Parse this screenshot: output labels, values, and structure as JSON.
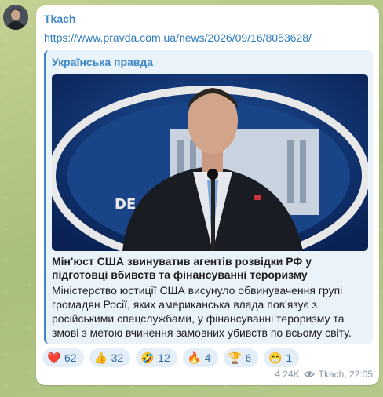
{
  "message": {
    "author": "Tkach",
    "link_text": "https://www.pravda.com.ua/news/2026/09/16/8053628/",
    "preview": {
      "site_name": "Українська правда",
      "headline": "Мін'юст США звинуватив агентів розвідки РФ у підготовці вбивств та фінансуванні тероризму",
      "description": "Міністерство юстиції США висунуло обвинувачення групі громадян Росії, яких американська влада пов'язує з російськими спецслужбами, у фінансуванні тероризму та змові з метою вчинення замовних убивств по всьому світу.",
      "image_icon": "news-photo-speaker-at-podium"
    },
    "reactions": [
      {
        "emoji": "❤️",
        "icon": "heart-icon",
        "count": "62"
      },
      {
        "emoji": "👍",
        "icon": "thumbs-up-icon",
        "count": "32"
      },
      {
        "emoji": "🤣",
        "icon": "laughing-icon",
        "count": "12"
      },
      {
        "emoji": "🔥",
        "icon": "fire-icon",
        "count": "4"
      },
      {
        "emoji": "🏆",
        "icon": "trophy-icon",
        "count": "6"
      },
      {
        "emoji": "😁",
        "icon": "grin-icon",
        "count": "1"
      }
    ],
    "views": "4.24K",
    "signature": "Tkach, 22:05"
  },
  "colors": {
    "accent": "#3d87c7",
    "bubble": "#ffffff",
    "preview_bg": "#eaf2fa",
    "reaction_bg": "#e3eef8"
  }
}
